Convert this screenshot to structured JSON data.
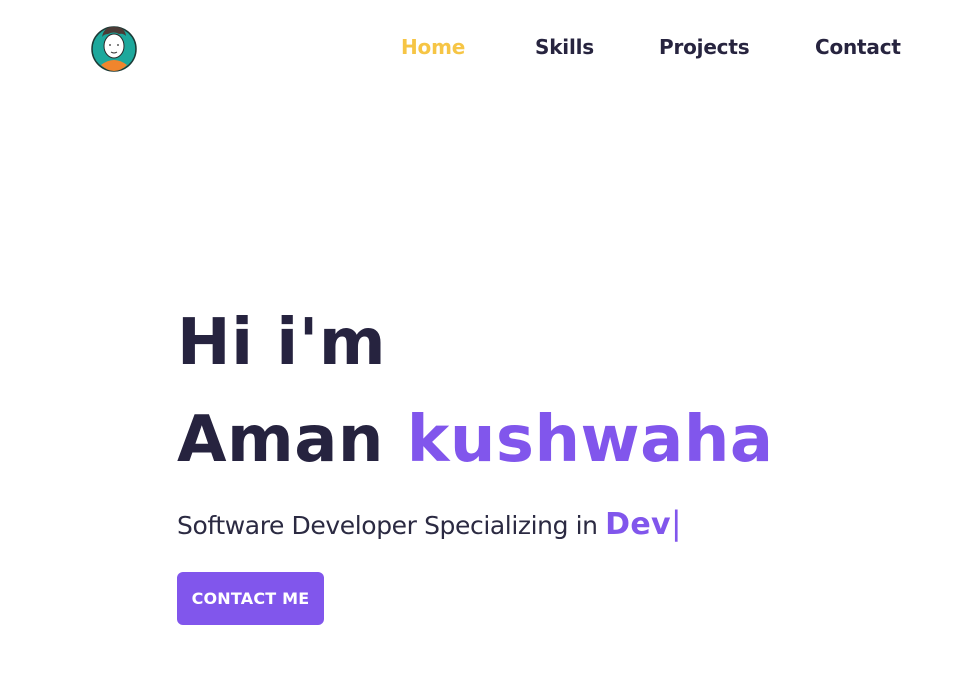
{
  "header": {
    "logo_icon": "avatar-icon",
    "nav": [
      {
        "label": "Home",
        "active": true
      },
      {
        "label": "Skills",
        "active": false
      },
      {
        "label": "Projects",
        "active": false
      },
      {
        "label": "Contact",
        "active": false
      }
    ]
  },
  "hero": {
    "greeting": "Hi i'm",
    "first_name": "Aman",
    "last_name": "kushwaha",
    "tagline_prefix": "Software Developer Specializing in",
    "typed_word": "Dev",
    "cursor": "|",
    "cta_label": "CONTACT ME"
  },
  "colors": {
    "accent": "#8156ec",
    "active_nav": "#f6c545",
    "text_dark": "#26233f",
    "background": "#ffffff"
  }
}
